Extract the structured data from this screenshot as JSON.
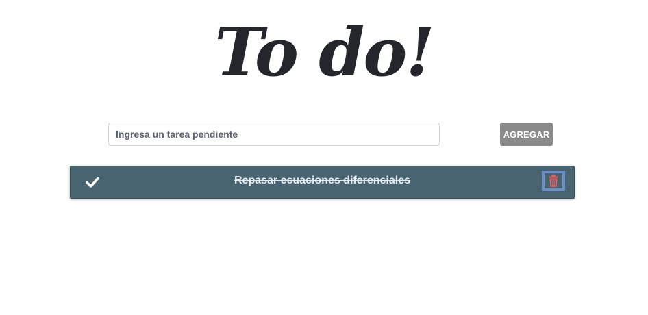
{
  "header": {
    "title": "To do!"
  },
  "form": {
    "input_value": "",
    "input_placeholder": "Ingresa un tarea pendiente",
    "add_label": "AGREGAR"
  },
  "todos": [
    {
      "text": "Repasar ecuaciones diferenciales",
      "completed": true,
      "check_icon": "check-icon",
      "delete_icon": "trash-icon"
    }
  ],
  "colors": {
    "title": "#24262b",
    "item_background": "#486470",
    "add_button": "#8a8a8a",
    "delete_icon": "#e86464",
    "delete_focus_border": "#6a8fc7"
  }
}
